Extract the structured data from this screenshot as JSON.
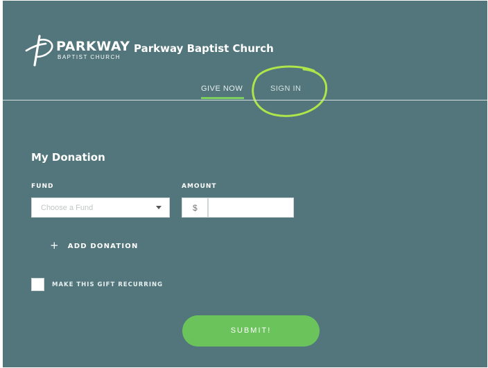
{
  "header": {
    "logo_wordmark": "PARKWAY",
    "logo_subtitle": "BAPTIST CHURCH",
    "org_name": "Parkway Baptist Church",
    "logo_icon": "cross-icon"
  },
  "nav": {
    "give_now": "GIVE NOW",
    "sign_in": "SIGN IN"
  },
  "form": {
    "title": "My Donation",
    "fund_label": "FUND",
    "fund_placeholder": "Choose a Fund",
    "amount_label": "AMOUNT",
    "currency_symbol": "$",
    "amount_value": "",
    "add_donation_icon": "+",
    "add_donation_label": "ADD DONATION",
    "recurring_label": "MAKE THIS GIFT RECURRING",
    "recurring_checked": false,
    "submit_label": "SUBMIT!"
  },
  "colors": {
    "background": "#52767b",
    "accent": "#6bc45b",
    "highlight": "#b8f246"
  }
}
